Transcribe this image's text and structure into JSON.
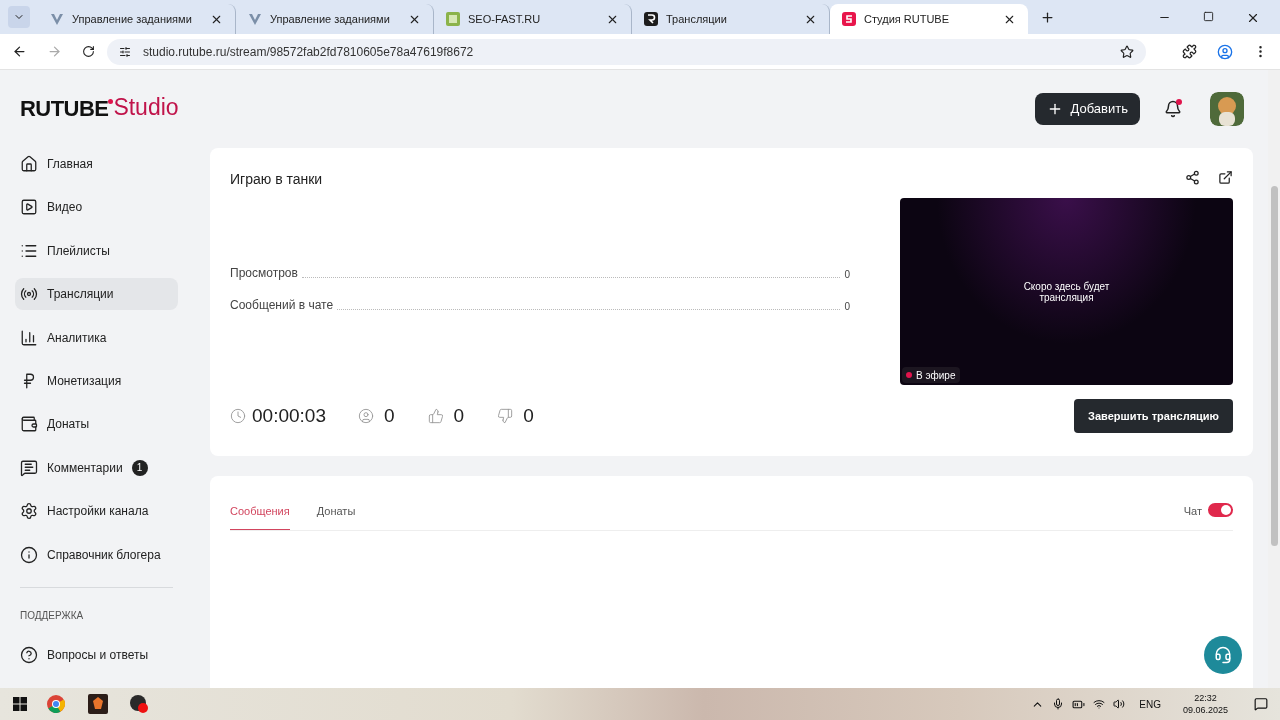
{
  "browser": {
    "tabs": [
      {
        "title": "Управление заданиями",
        "selected": false,
        "kind": "v"
      },
      {
        "title": "Управление заданиями",
        "selected": false,
        "kind": "v"
      },
      {
        "title": "SEO-FAST.RU",
        "selected": false,
        "kind": "sf"
      },
      {
        "title": "Трансляции",
        "selected": false,
        "kind": "r"
      },
      {
        "title": "Студия RUTUBE",
        "selected": true,
        "kind": "s"
      }
    ],
    "url": "studio.rutube.ru/stream/98572fab2fd7810605e78a47619f8672"
  },
  "logo": {
    "brand": "RUTUBE",
    "product": "Studio"
  },
  "sidebar": {
    "items": [
      {
        "label": "Главная",
        "selected": false
      },
      {
        "label": "Видео",
        "selected": false
      },
      {
        "label": "Плейлисты",
        "selected": false
      },
      {
        "label": "Трансляции",
        "selected": true
      },
      {
        "label": "Аналитика",
        "selected": false
      },
      {
        "label": "Монетизация",
        "selected": false
      },
      {
        "label": "Донаты",
        "selected": false
      },
      {
        "label": "Комментарии",
        "selected": false,
        "badge": "1"
      },
      {
        "label": "Настройки канала",
        "selected": false
      },
      {
        "label": "Справочник блогера",
        "selected": false
      }
    ],
    "section_title": "ПОДДЕРЖКА",
    "support_items": [
      {
        "label": "Вопросы и ответы"
      }
    ]
  },
  "header": {
    "add_button": "Добавить",
    "notifications_unread": true
  },
  "stream": {
    "title": "Играю в танки",
    "stats": [
      {
        "label": "Просмотров",
        "value": "0"
      },
      {
        "label": "Сообщений в чате",
        "value": "0"
      }
    ],
    "duration": "00:00:03",
    "viewers": "0",
    "likes": "0",
    "dislikes": "0",
    "preview": {
      "message": "Скоро здесь будет трансляция",
      "status": "В эфире",
      "live": true
    },
    "end_button": "Завершить трансляцию"
  },
  "chat": {
    "tabs": [
      {
        "label": "Сообщения",
        "selected": true
      },
      {
        "label": "Донаты",
        "selected": false
      }
    ],
    "toggle": {
      "label": "Чат",
      "on": true
    }
  },
  "taskbar": {
    "language": "ENG",
    "time": "22:32",
    "date": "09.06.2025"
  }
}
